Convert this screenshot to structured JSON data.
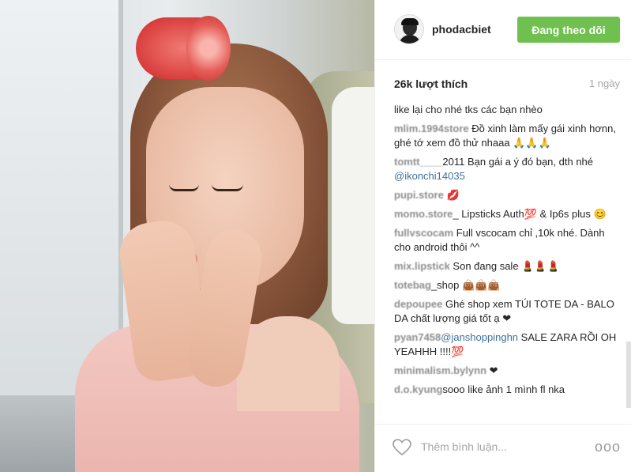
{
  "post": {
    "username": "phodacbiet",
    "follow_label": "Đang theo dõi",
    "likes": "26k lượt thích",
    "time": "1 ngày"
  },
  "comments": [
    {
      "user": "",
      "text": "like lại cho nhé tks các bạn nhèo",
      "mention": ""
    },
    {
      "user": "mlim.1994store",
      "text": " Đồ xinh làm mấy gái xinh hơnn, ghé tớ xem đồ thử nhaaa 🙏🙏🙏",
      "mention": ""
    },
    {
      "user": "tomtt____",
      "text": "2011 Bạn gái a ý đó bạn, dth nhé ",
      "mention": "@ikonchi14035"
    },
    {
      "user": "pupi.store",
      "text": " 💋",
      "mention": ""
    },
    {
      "user": "momo.store",
      "text": "_ Lipsticks Auth💯 & Ip6s plus 😊",
      "mention": ""
    },
    {
      "user": "fullvscocam",
      "text": " Full vscocam chỉ ,10k nhé. Dành cho android thôi ^^",
      "mention": ""
    },
    {
      "user": "mix.lipstick",
      "text": " Son đang sale 💄💄💄",
      "mention": ""
    },
    {
      "user": "totebag",
      "text": "_shop 👜👜👜",
      "mention": ""
    },
    {
      "user": "depoupee",
      "text": " Ghé shop xem TÚI TOTE DA - BALO DA chất lượng giá tốt ạ ❤",
      "mention": ""
    },
    {
      "user": "pyan7458",
      "text": " SALE ZARA RỒI OH YEAHHH !!!!💯",
      "mention": "@janshoppinghn"
    },
    {
      "user": "minimalism.bylynn",
      "text": " ❤",
      "mention": ""
    },
    {
      "user": "d.o.kyung",
      "text": "sooo like ảnh 1 mình fl nka",
      "mention": ""
    }
  ],
  "footer": {
    "comment_placeholder": "Thêm bình luận...",
    "more_label": "ooo",
    "heart_icon": "heart-icon"
  },
  "colors": {
    "follow_button": "#70c050",
    "mention": "#3f729b",
    "muted": "#a5a7aa"
  }
}
